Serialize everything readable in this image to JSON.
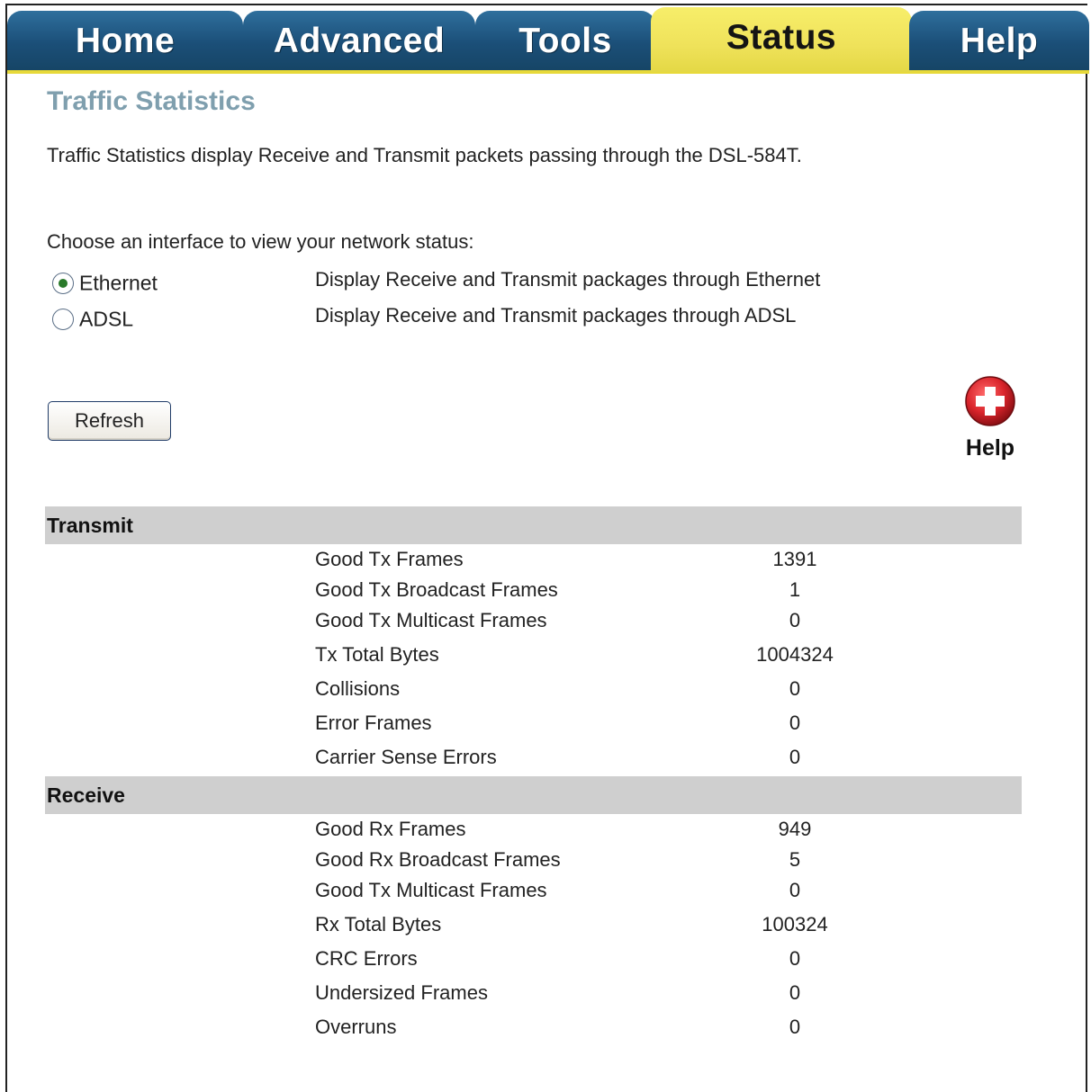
{
  "tabs": [
    {
      "label": "Home"
    },
    {
      "label": "Advanced"
    },
    {
      "label": "Tools"
    },
    {
      "label": "Status",
      "active": true
    },
    {
      "label": "Help"
    }
  ],
  "page": {
    "title": "Traffic Statistics",
    "description": "Traffic Statistics display Receive and Transmit packets passing through the DSL-584T.",
    "choose_label": "Choose an interface to view your network status:"
  },
  "interfaces": [
    {
      "label": "Ethernet",
      "description": "Display Receive and Transmit packages through Ethernet",
      "selected": true
    },
    {
      "label": "ADSL",
      "description": "Display Receive and Transmit packages through ADSL",
      "selected": false
    }
  ],
  "refresh_label": "Refresh",
  "help_label": "Help",
  "colors": {
    "tab_blue": "#1b4f78",
    "tab_active_yellow": "#efe25a",
    "title_color": "#7f9fae",
    "section_bg": "#cfcfcf",
    "help_icon_red": "#d9242b"
  },
  "transmit": {
    "title": "Transmit",
    "rows": [
      {
        "label": "Good Tx Frames",
        "value": "1391"
      },
      {
        "label": "Good Tx Broadcast Frames",
        "value": "1"
      },
      {
        "label": "Good Tx Multicast Frames",
        "value": "0"
      },
      {
        "label": "Tx Total Bytes",
        "value": "1004324"
      },
      {
        "label": "Collisions",
        "value": "0"
      },
      {
        "label": "Error Frames",
        "value": "0"
      },
      {
        "label": "Carrier Sense Errors",
        "value": "0"
      }
    ]
  },
  "receive": {
    "title": "Receive",
    "rows": [
      {
        "label": "Good Rx Frames",
        "value": "949"
      },
      {
        "label": "Good Rx Broadcast Frames",
        "value": "5"
      },
      {
        "label": "Good Tx Multicast Frames",
        "value": "0"
      },
      {
        "label": "Rx Total Bytes",
        "value": "100324"
      },
      {
        "label": "CRC Errors",
        "value": "0"
      },
      {
        "label": "Undersized Frames",
        "value": "0"
      },
      {
        "label": "Overruns",
        "value": "0"
      }
    ]
  }
}
